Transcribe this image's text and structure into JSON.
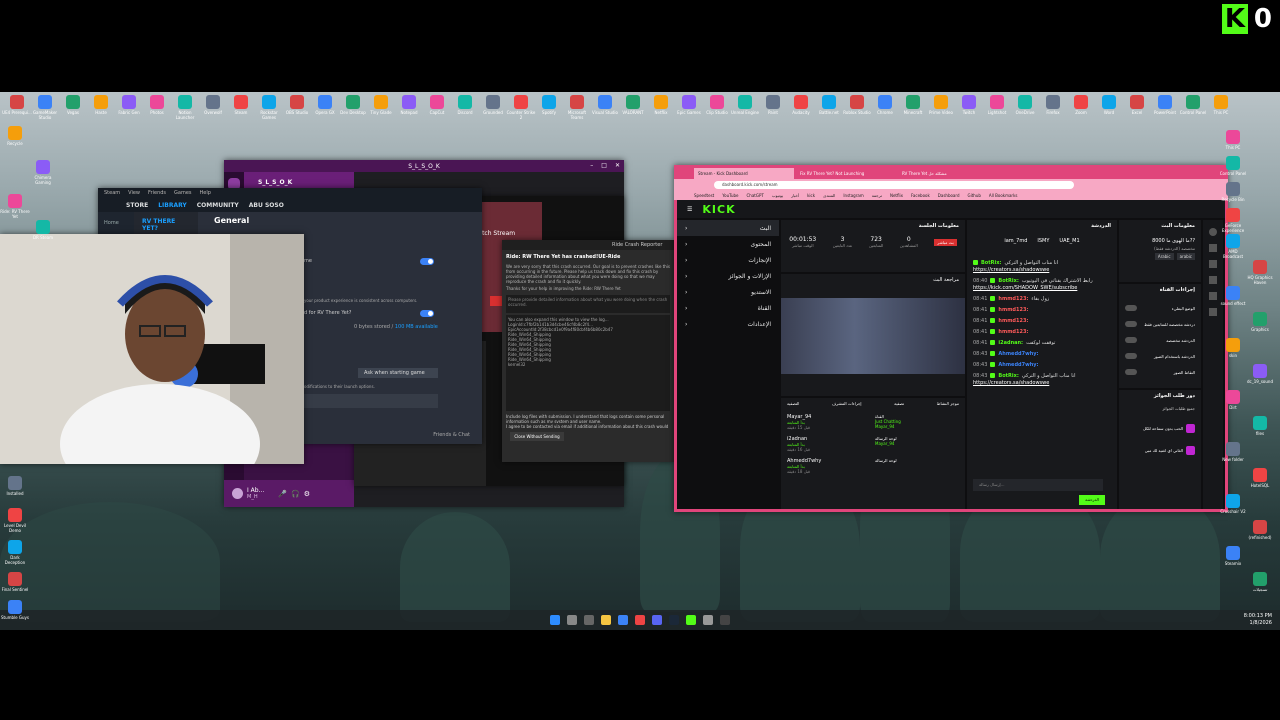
{
  "overlay": {
    "brand": "K",
    "counter": "0"
  },
  "desktop_icons_top": [
    "UE4 Prerequi...",
    "GameMaker Studio",
    "Vegas",
    "Haste",
    "Fabric Gen",
    "Photos",
    "Notion Launcher",
    "Overwolf",
    "Steam",
    "Rockstar Games",
    "OBS Studio",
    "Opera GX",
    "Dev Desktop",
    "Tiny Glade",
    "Notepad",
    "CapCut",
    "Discord",
    "Grounded",
    "Counter Strike 2",
    "Spotify",
    "Microsoft Teams",
    "Visual Studio",
    "VALORANT",
    "Netflix",
    "Epic Games",
    "Clip Studio",
    "Unreal Engine",
    "Paint",
    "Audacity",
    "Battle.net",
    "Roblox Studio",
    "Chrome",
    "Minecraft",
    "Prime Video",
    "Twitch",
    "Lightshot",
    "OneDrive",
    "Firefox",
    "Zoom",
    "Word",
    "Excel",
    "PowerPoint",
    "Control Panel",
    "This PC"
  ],
  "desktop_icons_left": [
    "Recycle",
    "Chimera Gaming",
    "Ride: RV There Yet",
    "DR Steam",
    "Installed",
    "Level Devil Demo",
    "Dark Deception",
    "Final Sentinel",
    "Stumble Guys"
  ],
  "desktop_icons_right": [
    "This PC",
    "Control Panel",
    "Recycle Bin",
    "GeForce Experience",
    "AMD Broadcast",
    "HQ Graphics Haven",
    "sound effect",
    "Graphics",
    "skin",
    "dc_19_sound",
    "Dirt",
    "files",
    "New folder",
    "HotelSQL",
    "Crosshair V2",
    "(refinished)",
    "Steamix",
    "تسجيلات"
  ],
  "discord": {
    "server_name": "S_L_S_O_K",
    "window_title": "S_L_S_O_K",
    "username": "I Ab...",
    "status": "M_H",
    "user_tag": "ABU SOSO"
  },
  "steam": {
    "menu": [
      "Steam",
      "View",
      "Friends",
      "Games",
      "Help"
    ],
    "nav": [
      "STORE",
      "LIBRARY",
      "COMMUNITY",
      "ABU SOSO"
    ],
    "home": "Home",
    "game_title": "RV THERE YET?",
    "section": "General",
    "toggle_label_1": "me",
    "hint": "your product experience is consistent across computers.",
    "toggle_label_2": "d for RV There Yet?",
    "storage": "0 bytes stored / ",
    "storage_avail": "100 MB available",
    "launch_label": "Ask when starting game",
    "launch_hint": "odifications to their launch options.",
    "friends": "Friends & Chat"
  },
  "crash": {
    "title": "Ride Crash Reporter",
    "heading": "Ride: RW There Yet has crashed!UE-Ride",
    "body": "We are very sorry that this crash occurred. Our goal is to prevent crashes like this from occurring in the future. Please help us track down and fix this crash by providing detailed information about what you were doing so that we may reproduce the crash and fix it quickly.",
    "thanks": "Thanks for your help in improving the Ride: RW There Yet",
    "prompt": "Please provide detailed information about what you were doing when the crash occurred.",
    "log_intro": "You can also expand this window to view the log...",
    "log_lines": [
      "LoginId:c7fbf2b141b3d4cbe46cf4b8c2f4...",
      "EpicAccountId:2f38cbcd1e0f9a4f80cbf4b6b80c2b47",
      "Ride_Win64_Shipping",
      "Ride_Win64_Shipping",
      "Ride_Win64_Shipping",
      "Ride_Win64_Shipping",
      "Ride_Win64_Shipping",
      "Ride_Win64_Shipping",
      "kernel32"
    ],
    "checkbox_1": "Include log files with submission. I understand that logs contain some personal information such as my system and user name.",
    "checkbox_2": "I agree to be contacted via email if additional information about this crash would help fix it.",
    "button": "Close Without Sending"
  },
  "stream_window": {
    "watch_stream": "Watch Stream",
    "live": "LIVE",
    "user": "Abu Suldan"
  },
  "kick": {
    "tabs": [
      "Stream - Kick Dashboard",
      "Fix RV There Yet? Not Launching",
      "RV There Yet مشكلة حل"
    ],
    "url": "dashboard.kick.com/stream",
    "bookmarks": [
      "Speedtest",
      "YouTube",
      "ChatGPT",
      "يوتيوب",
      "أخبار",
      "kick",
      "المنتدى",
      "Instagram",
      "ترجمة",
      "Netflix",
      "Facebook",
      "Dashboard",
      "Github",
      "All Bookmarks"
    ],
    "logo": "KICK",
    "nav": [
      "البث",
      "المحتوى",
      "الإنجازات",
      "الإزالات و الجوائز",
      "الاستديو",
      "القناة",
      "الإعدادات"
    ],
    "session_title": "معلومات الجلسة",
    "stats": [
      {
        "value": "00:01:53",
        "label": "الوقت مباشر"
      },
      {
        "value": "3",
        "label": "عدد التابعين"
      },
      {
        "value": "723",
        "label": "المتابعين"
      },
      {
        "value": "0",
        "label": "المشاهدين"
      }
    ],
    "live_badge": "بث مباشر",
    "preview_title": "مراجعة البث",
    "activity_title": "موجز النشاط",
    "activity_tabs": [
      "التصفية",
      "إجراءات المشرف",
      "تصفية"
    ],
    "activity": [
      {
        "user": "Mayar_94",
        "text": "بدأ المتابعة",
        "time": "قبل 15 دقيقة"
      },
      {
        "user": "i2adnan",
        "text": "بدأ المتابعة",
        "time": "قبل 16 دقيقة"
      },
      {
        "user": "Ahmedd7why",
        "text": "بدأ المتابعة",
        "time": "قبل 18 دقيقة"
      }
    ],
    "mod_actions": [
      {
        "title": "القناة",
        "text": "Just Chatting",
        "user": "Mayar_94"
      },
      {
        "title": "لوحة الرسالة",
        "text": "",
        "user": "Mayar_94"
      },
      {
        "title": "لوحة الرسالة",
        "text": "",
        "user": ""
      }
    ],
    "chat_title": "الدردشة",
    "chat_top": [
      "iam_7md",
      "ISMY",
      "UAE_M1"
    ],
    "chat": [
      {
        "time": "",
        "user": "BotRix",
        "text": "انا مناب التواصل و التركي",
        "link": "https://creators.sa/shadowswe"
      },
      {
        "time": "08:40",
        "user": "BotRix",
        "text": "رابط الاشتراك بقناتي في اليوتيوب",
        "link": "https://kick.com/SHADOW_SWE/subscribe"
      },
      {
        "time": "08:41",
        "user": "hmmd123",
        "text": "زول بقاء"
      },
      {
        "time": "08:41",
        "user": "hmmd123",
        "text": ""
      },
      {
        "time": "08:41",
        "user": "hmmd123",
        "text": ""
      },
      {
        "time": "08:41",
        "user": "hmmd123",
        "text": ""
      },
      {
        "time": "08:41",
        "user": "i2adnan",
        "text": "توقفت لوكفت"
      },
      {
        "time": "08:43",
        "user": "Ahmedd7why",
        "text": ""
      },
      {
        "time": "08:43",
        "user": "Ahmedd7why",
        "text": ""
      },
      {
        "time": "08:43",
        "user": "BotRix",
        "text": "انا مناب التواصل و التركي",
        "link": "https://creators.sa/shadowswe"
      }
    ],
    "chat_placeholder": "إرسال رسالة...",
    "chat_send": "الدردشة",
    "stream_info_title": "معلومات البث",
    "stream_info_name": "ما الهوى ما 8000??",
    "stream_info_cat": "مخصصة (الدردشة فقط)",
    "stream_tags": [
      "Arabic",
      "arabic"
    ],
    "channel_actions_title": "إجراءات القناة",
    "channel_actions": [
      "الوضع البطيء",
      "دردشة مخصصة للمتابعين فقط",
      "الدردشة مخصصة",
      "الدردشة باستخدام الصور",
      "التقاط الصور"
    ],
    "rewards_title": "دور طلب الجوائز",
    "rewards_all": "جميع طلبات الجوائز",
    "rewards": [
      {
        "text": "الحب بدون سماحة للكل"
      },
      {
        "text": "الغاني اي اغنية لك مبي"
      }
    ]
  },
  "tray": {
    "time": "8:00:13 PM",
    "date": "1/8/2026"
  },
  "colors": {
    "kick_green": "#53fc18",
    "kick_frame": "#e0457b",
    "discord_purple": "#7a2a8a"
  }
}
